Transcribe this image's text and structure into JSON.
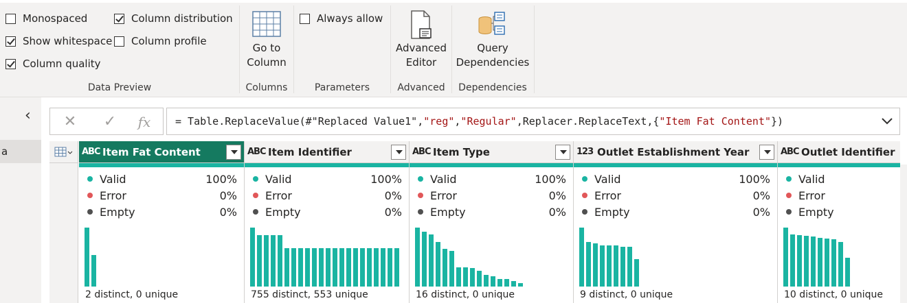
{
  "ribbon": {
    "data_preview": {
      "label": "Data Preview",
      "checks": [
        {
          "label": "Monospaced",
          "checked": false
        },
        {
          "label": "Show whitespace",
          "checked": true
        },
        {
          "label": "Column quality",
          "checked": true
        },
        {
          "label": "Column distribution",
          "checked": true
        },
        {
          "label": "Column profile",
          "checked": false
        }
      ]
    },
    "columns": {
      "label": "Columns",
      "go_to_line1": "Go to",
      "go_to_line2": "Column"
    },
    "parameters": {
      "label": "Parameters",
      "always_allow": "Always allow",
      "always_allow_checked": false
    },
    "advanced": {
      "label": "Advanced",
      "btn_line1": "Advanced",
      "btn_line2": "Editor"
    },
    "dependencies": {
      "label": "Dependencies",
      "btn_line1": "Query",
      "btn_line2": "Dependencies"
    }
  },
  "left_panel": {
    "collapse_glyph": "‹",
    "query_item": "a"
  },
  "formula_bar": {
    "cancel_glyph": "✕",
    "commit_glyph": "✓",
    "fx_glyph": "fx",
    "parts": [
      "= Table.ReplaceValue(#\"Replaced Value1\",",
      "\"reg\"",
      ",",
      "\"Regular\"",
      ",Replacer.ReplaceText,{",
      "\"Item Fat Content\"",
      "})"
    ]
  },
  "grid": {
    "colors": {
      "valid": "#1ab4a2",
      "error": "#e15759",
      "empty": "#505050",
      "active_header": "#157a60"
    },
    "quality_labels": {
      "valid": "Valid",
      "error": "Error",
      "empty": "Empty"
    },
    "columns": [
      {
        "type": "ABC",
        "name": "Item Fat Content",
        "active": true,
        "valid": "100%",
        "error": "0%",
        "empty": "0%",
        "distinct": "2 distinct, 0 unique",
        "hist": [
          1.0,
          0.53
        ]
      },
      {
        "type": "ABC",
        "name": "Item Identifier",
        "active": false,
        "valid": "100%",
        "error": "0%",
        "empty": "0%",
        "distinct": "755 distinct, 553 unique",
        "hist": [
          1.0,
          0.87,
          0.87,
          0.87,
          0.87,
          0.65,
          0.65,
          0.65,
          0.65,
          0.65,
          0.65,
          0.65,
          0.65,
          0.65,
          0.65,
          0.65,
          0.65,
          0.65,
          0.65,
          0.65,
          0.65,
          0.65
        ]
      },
      {
        "type": "ABC",
        "name": "Item Type",
        "active": false,
        "valid": "100%",
        "error": "0%",
        "empty": "0%",
        "distinct": "16 distinct, 0 unique",
        "hist": [
          1.0,
          0.93,
          0.88,
          0.76,
          0.64,
          0.6,
          0.33,
          0.33,
          0.31,
          0.27,
          0.2,
          0.18,
          0.13,
          0.13,
          0.09,
          0.06
        ]
      },
      {
        "type": "123",
        "name": "Outlet Establishment Year",
        "active": false,
        "valid": "100%",
        "error": "0%",
        "empty": "0%",
        "distinct": "9 distinct, 0 unique",
        "hist": [
          1.0,
          0.76,
          0.73,
          0.7,
          0.7,
          0.7,
          0.67,
          0.67,
          0.47
        ]
      },
      {
        "type": "ABC",
        "name": "Outlet Identifier",
        "active": false,
        "valid": "100%",
        "error": "0%",
        "empty": "0%",
        "distinct": "10 distinct, 0 unique",
        "hist": [
          1.0,
          0.88,
          0.87,
          0.86,
          0.85,
          0.82,
          0.81,
          0.8,
          0.76,
          0.49
        ]
      }
    ]
  }
}
